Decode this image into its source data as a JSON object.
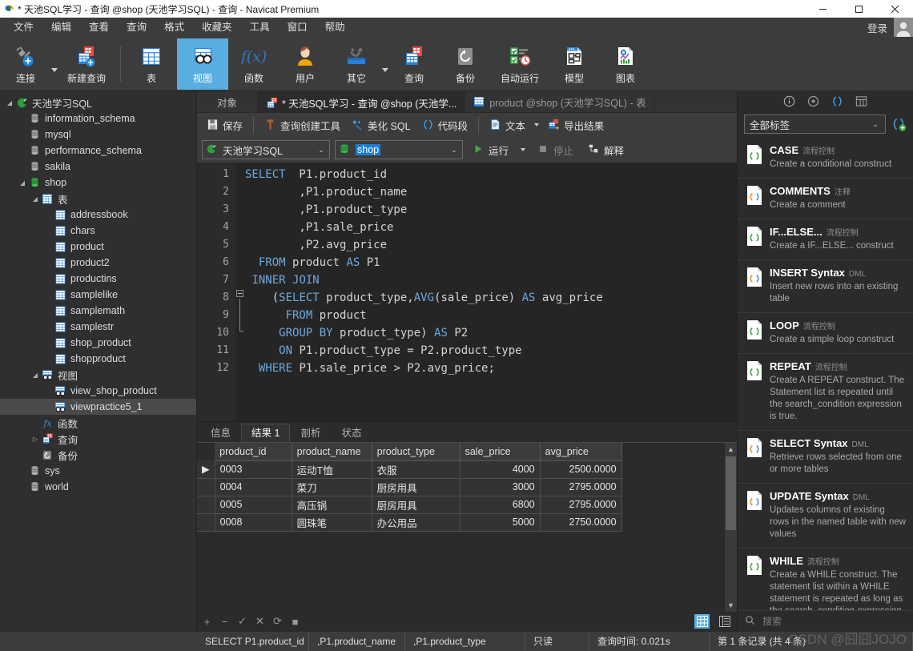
{
  "window": {
    "title": "* 天池SQL学习 - 查询 @shop (天池学习SQL) - 查询 - Navicat Premium",
    "minimize": "—",
    "maximize": "□",
    "close": "✕"
  },
  "menubar": {
    "items": [
      "文件",
      "编辑",
      "查看",
      "查询",
      "格式",
      "收藏夹",
      "工具",
      "窗口",
      "帮助"
    ],
    "login": "登录"
  },
  "toolbar": {
    "items": [
      {
        "label": "连接",
        "icon": "connection-icon",
        "caret": true
      },
      {
        "label": "新建查询",
        "icon": "new-query-icon",
        "caret": false
      },
      {
        "label": "表",
        "icon": "table-icon",
        "caret": false
      },
      {
        "label": "视图",
        "icon": "view-icon",
        "caret": false,
        "active": true
      },
      {
        "label": "函数",
        "icon": "function-icon",
        "caret": false
      },
      {
        "label": "用户",
        "icon": "user-icon",
        "caret": false
      },
      {
        "label": "其它",
        "icon": "other-tools-icon",
        "caret": true
      },
      {
        "label": "查询",
        "icon": "query-icon",
        "caret": false
      },
      {
        "label": "备份",
        "icon": "backup-icon",
        "caret": false
      },
      {
        "label": "自动运行",
        "icon": "automation-icon",
        "caret": false
      },
      {
        "label": "模型",
        "icon": "model-icon",
        "caret": false
      },
      {
        "label": "图表",
        "icon": "chart-icon",
        "caret": false
      }
    ]
  },
  "tree": {
    "items": [
      {
        "label": "天池学习SQL",
        "depth": 0,
        "icon": "connection-icon",
        "twist": "open"
      },
      {
        "label": "information_schema",
        "depth": 1,
        "icon": "database-icon",
        "twist": ""
      },
      {
        "label": "mysql",
        "depth": 1,
        "icon": "database-icon",
        "twist": ""
      },
      {
        "label": "performance_schema",
        "depth": 1,
        "icon": "database-icon",
        "twist": ""
      },
      {
        "label": "sakila",
        "depth": 1,
        "icon": "database-icon",
        "twist": ""
      },
      {
        "label": "shop",
        "depth": 1,
        "icon": "database-open-icon",
        "twist": "open"
      },
      {
        "label": "表",
        "depth": 2,
        "icon": "tables-folder-icon",
        "twist": "open"
      },
      {
        "label": "addressbook",
        "depth": 3,
        "icon": "table-icon",
        "twist": ""
      },
      {
        "label": "chars",
        "depth": 3,
        "icon": "table-icon",
        "twist": ""
      },
      {
        "label": "product",
        "depth": 3,
        "icon": "table-icon",
        "twist": ""
      },
      {
        "label": "product2",
        "depth": 3,
        "icon": "table-icon",
        "twist": ""
      },
      {
        "label": "productins",
        "depth": 3,
        "icon": "table-icon",
        "twist": ""
      },
      {
        "label": "samplelike",
        "depth": 3,
        "icon": "table-icon",
        "twist": ""
      },
      {
        "label": "samplemath",
        "depth": 3,
        "icon": "table-icon",
        "twist": ""
      },
      {
        "label": "samplestr",
        "depth": 3,
        "icon": "table-icon",
        "twist": ""
      },
      {
        "label": "shop_product",
        "depth": 3,
        "icon": "table-icon",
        "twist": ""
      },
      {
        "label": "shopproduct",
        "depth": 3,
        "icon": "table-icon",
        "twist": ""
      },
      {
        "label": "视图",
        "depth": 2,
        "icon": "views-folder-icon",
        "twist": "open"
      },
      {
        "label": "view_shop_product",
        "depth": 3,
        "icon": "view-icon",
        "twist": ""
      },
      {
        "label": "viewpractice5_1",
        "depth": 3,
        "icon": "view-icon",
        "twist": "",
        "selected": true
      },
      {
        "label": "函数",
        "depth": 2,
        "icon": "function-icon",
        "twist": ""
      },
      {
        "label": "查询",
        "depth": 2,
        "icon": "query-icon",
        "twist": "closed"
      },
      {
        "label": "备份",
        "depth": 2,
        "icon": "backup-icon",
        "twist": ""
      },
      {
        "label": "sys",
        "depth": 1,
        "icon": "database-icon",
        "twist": ""
      },
      {
        "label": "world",
        "depth": 1,
        "icon": "database-icon",
        "twist": ""
      }
    ]
  },
  "tabs": {
    "objects_label": "对象",
    "items": [
      {
        "label": "* 天池SQL学习 - 查询 @shop (天池学...",
        "icon": "query-icon",
        "active": true
      },
      {
        "label": "product @shop (天池学习SQL) - 表",
        "icon": "table-icon",
        "active": false
      }
    ]
  },
  "editor_toolbar": {
    "save": "保存",
    "query_builder": "查询创建工具",
    "beautify": "美化 SQL",
    "snippet": "代码段",
    "text": "文本",
    "export_result": "导出结果"
  },
  "run_bar": {
    "connection": "天池学习SQL",
    "database": "shop",
    "run": "运行",
    "stop": "停止",
    "explain": "解释"
  },
  "sql": {
    "lines": [
      {
        "n": 1,
        "tokens": [
          {
            "t": "SELECT",
            "k": 1
          },
          {
            "t": "  P1.product_id",
            "k": 0
          }
        ]
      },
      {
        "n": 2,
        "tokens": [
          {
            "t": "        ,P1.product_name",
            "k": 0
          }
        ]
      },
      {
        "n": 3,
        "tokens": [
          {
            "t": "        ,P1.product_type",
            "k": 0
          }
        ]
      },
      {
        "n": 4,
        "tokens": [
          {
            "t": "        ,P1.sale_price",
            "k": 0
          }
        ]
      },
      {
        "n": 5,
        "tokens": [
          {
            "t": "        ,P2.avg_price",
            "k": 0
          }
        ]
      },
      {
        "n": 6,
        "tokens": [
          {
            "t": "  ",
            "k": 0
          },
          {
            "t": "FROM",
            "k": 1
          },
          {
            "t": " product ",
            "k": 0
          },
          {
            "t": "AS",
            "k": 1
          },
          {
            "t": " P1",
            "k": 0
          }
        ]
      },
      {
        "n": 7,
        "tokens": [
          {
            "t": " ",
            "k": 0
          },
          {
            "t": "INNER JOIN",
            "k": 1
          }
        ]
      },
      {
        "n": 8,
        "tokens": [
          {
            "t": "    (",
            "k": 0
          },
          {
            "t": "SELECT",
            "k": 1
          },
          {
            "t": " product_type,",
            "k": 0
          },
          {
            "t": "AVG",
            "k": 1
          },
          {
            "t": "(sale_price) ",
            "k": 0
          },
          {
            "t": "AS",
            "k": 1
          },
          {
            "t": " avg_price",
            "k": 0
          }
        ]
      },
      {
        "n": 9,
        "tokens": [
          {
            "t": "      ",
            "k": 0
          },
          {
            "t": "FROM",
            "k": 1
          },
          {
            "t": " product",
            "k": 0
          }
        ]
      },
      {
        "n": 10,
        "tokens": [
          {
            "t": "     ",
            "k": 0
          },
          {
            "t": "GROUP BY",
            "k": 1
          },
          {
            "t": " product_type) ",
            "k": 0
          },
          {
            "t": "AS",
            "k": 1
          },
          {
            "t": " P2",
            "k": 0
          }
        ]
      },
      {
        "n": 11,
        "tokens": [
          {
            "t": "     ",
            "k": 0
          },
          {
            "t": "ON",
            "k": 1
          },
          {
            "t": " P1.product_type = P2.product_type",
            "k": 0
          }
        ]
      },
      {
        "n": 12,
        "tokens": [
          {
            "t": "  ",
            "k": 0
          },
          {
            "t": "WHERE",
            "k": 1
          },
          {
            "t": " P1.sale_price > P2.avg_price;",
            "k": 0
          }
        ]
      }
    ]
  },
  "results": {
    "tabs": [
      {
        "label": "信息",
        "active": false
      },
      {
        "label": "结果 1",
        "active": true
      },
      {
        "label": "剖析",
        "active": false
      },
      {
        "label": "状态",
        "active": false
      }
    ],
    "columns": [
      "product_id",
      "product_name",
      "product_type",
      "sale_price",
      "avg_price"
    ],
    "rows": [
      {
        "marker": "▶",
        "cells": [
          "0003",
          "运动T恤",
          "衣服",
          "4000",
          "2500.0000"
        ]
      },
      {
        "marker": "",
        "cells": [
          "0004",
          "菜刀",
          "厨房用具",
          "3000",
          "2795.0000"
        ]
      },
      {
        "marker": "",
        "cells": [
          "0005",
          "高压锅",
          "厨房用具",
          "6800",
          "2795.0000"
        ]
      },
      {
        "marker": "",
        "cells": [
          "0008",
          "圆珠笔",
          "办公用品",
          "5000",
          "2750.0000"
        ]
      }
    ],
    "footer_buttons": [
      "+",
      "−",
      "✓",
      "✕",
      "⟳",
      "■"
    ]
  },
  "right_panel": {
    "top_icons": [
      "info-icon",
      "target-icon",
      "snippet-icon",
      "grid-icon"
    ],
    "filter_value": "全部标签",
    "add_snippet_icon": "add-snippet-icon",
    "snippets": [
      {
        "title": "CASE",
        "tag": "流程控制",
        "desc": "Create a conditional construct",
        "color": "green"
      },
      {
        "title": "COMMENTS",
        "tag": "注释",
        "desc": "Create a comment",
        "color": "orange"
      },
      {
        "title": "IF...ELSE...",
        "tag": "流程控制",
        "desc": "Create a IF...ELSE... construct",
        "color": "green"
      },
      {
        "title": "INSERT Syntax",
        "tag": "DML",
        "desc": "Insert new rows into an existing table",
        "color": "orange"
      },
      {
        "title": "LOOP",
        "tag": "流程控制",
        "desc": "Create a simple loop construct",
        "color": "green"
      },
      {
        "title": "REPEAT",
        "tag": "流程控制",
        "desc": "Create A REPEAT construct. The Statement list is repeated until the search_condition expression is true.",
        "color": "green"
      },
      {
        "title": "SELECT Syntax",
        "tag": "DML",
        "desc": "Retrieve rows selected from one or more tables",
        "color": "orange"
      },
      {
        "title": "UPDATE Syntax",
        "tag": "DML",
        "desc": "Updates columns of existing rows in the named table with new values",
        "color": "orange"
      },
      {
        "title": "WHILE",
        "tag": "流程控制",
        "desc": "Create a WHILE construct. The statement list within a WHILE statement is repeated as long as the search_condition expression is true.",
        "color": "green"
      }
    ],
    "search_placeholder": "搜索"
  },
  "statusbar": {
    "cells": [
      "SELECT  P1.product_id",
      ",P1.product_name",
      ",P1.product_type",
      "只读",
      "查询时间: 0.021s",
      "第 1 条记录 (共 4 条)"
    ]
  },
  "watermark": "CSDN @囧囧JOJO",
  "colors": {
    "accent": "#5aade0",
    "chrome": "#3c3c3c",
    "canvas": "#2b2b2b",
    "editor_bg": "#252525",
    "keyword": "#6fa8dc",
    "selection": "#1a7fd4"
  }
}
